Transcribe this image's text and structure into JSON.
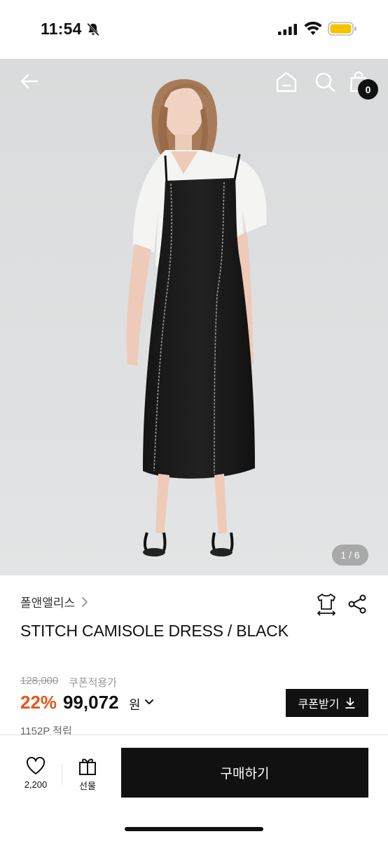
{
  "status_bar": {
    "time": "11:54"
  },
  "top_nav": {
    "cart_count": "0"
  },
  "gallery": {
    "counter": "1 / 6"
  },
  "product": {
    "brand": "폴앤앨리스",
    "title": "STITCH CAMISOLE DRESS / BLACK",
    "original_price": "128,000",
    "coupon_price_label": "쿠폰적용가",
    "discount": "22%",
    "price": "99,072",
    "currency": "원",
    "coupon_button": "쿠폰받기",
    "points": "1152P 적립"
  },
  "bottom_bar": {
    "like_count": "2,200",
    "gift_label": "선물",
    "buy_label": "구매하기"
  },
  "colors": {
    "accent": "#e4571d",
    "dark": "#111111",
    "photo_bg": "#dcdedf"
  }
}
